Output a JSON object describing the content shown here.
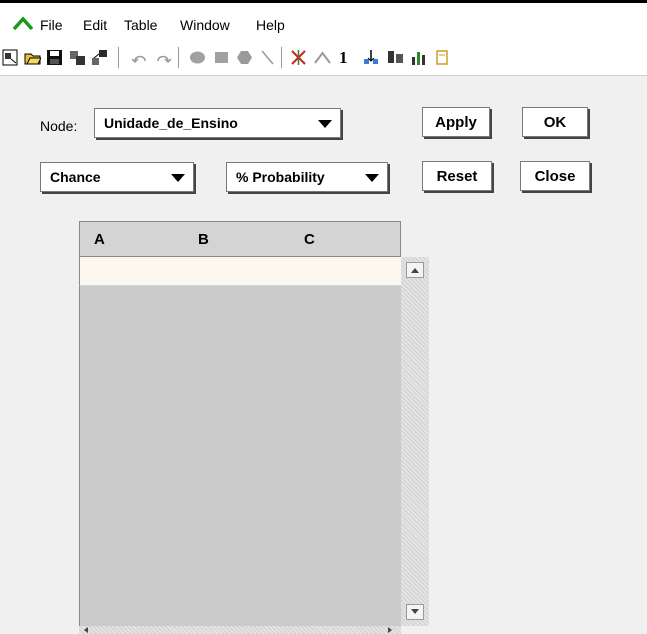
{
  "menu": {
    "items": [
      "File",
      "Edit",
      "Table",
      "Window",
      "Help"
    ]
  },
  "toolbar": {
    "icons": [
      "new-network-icon",
      "open-icon",
      "save-icon",
      "compile-icon",
      "network-icon",
      "undo-icon",
      "redo-icon",
      "chance-node-icon",
      "decision-node-icon",
      "utility-node-icon",
      "arrow-tool-icon",
      "delete-link-icon",
      "mountain-icon",
      "one-text-icon",
      "arc-reverse-icon",
      "case-icon",
      "bars-icon"
    ],
    "one_label": "1"
  },
  "node": {
    "label": "Node:",
    "value": "Unidade_de_Ensino"
  },
  "type_select": "Chance",
  "probability_select": "% Probability",
  "buttons": {
    "apply": "Apply",
    "ok": "OK",
    "reset": "Reset",
    "close": "Close"
  },
  "table": {
    "columns": [
      "A",
      "B",
      "C"
    ]
  }
}
